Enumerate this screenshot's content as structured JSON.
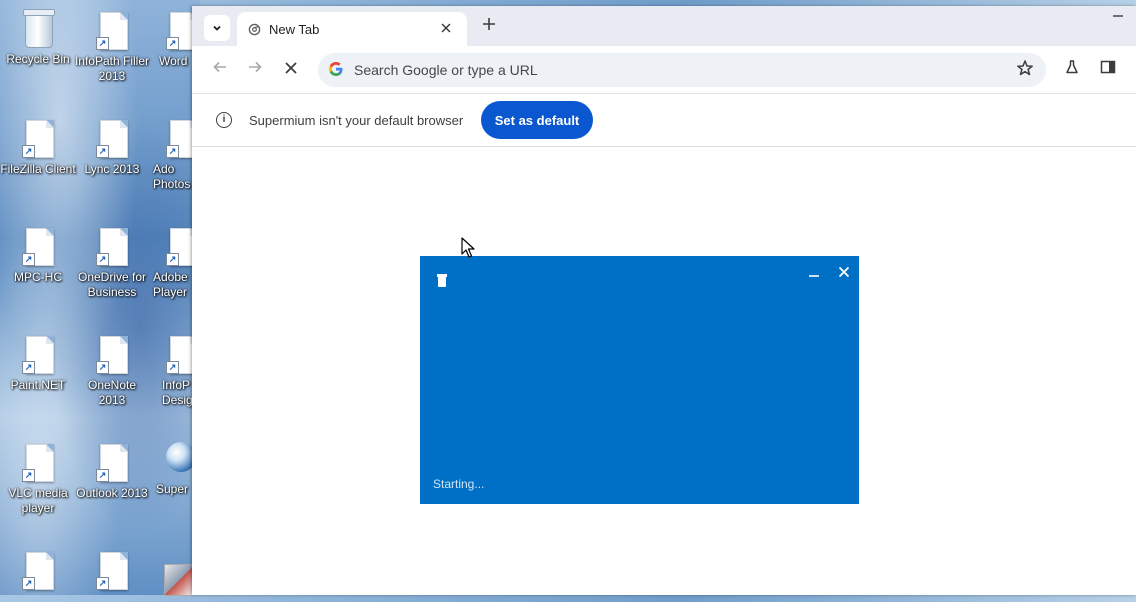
{
  "desktop": {
    "icons": [
      {
        "label": "Recycle Bin",
        "kind": "bin"
      },
      {
        "label": "InfoPath Filler 2013",
        "kind": "doc"
      },
      {
        "label": "Word",
        "kind": "doc"
      },
      {
        "label": "FileZilla Client",
        "kind": "doc"
      },
      {
        "label": "Lync 2013",
        "kind": "doc"
      },
      {
        "label": "Ado Photos",
        "kind": "doc"
      },
      {
        "label": "MPC-HC",
        "kind": "doc"
      },
      {
        "label": "OneDrive for Business",
        "kind": "doc"
      },
      {
        "label": "Adobe Player",
        "kind": "doc"
      },
      {
        "label": "Paint.NET",
        "kind": "doc"
      },
      {
        "label": "OneNote 2013",
        "kind": "doc"
      },
      {
        "label": "InfoP Desig",
        "kind": "doc"
      },
      {
        "label": "VLC media player",
        "kind": "doc"
      },
      {
        "label": "Outlook 2013",
        "kind": "doc"
      },
      {
        "label": "Super",
        "kind": "globe"
      }
    ]
  },
  "browser": {
    "tab": {
      "title": "New Tab"
    },
    "omnibox": {
      "placeholder": "Search Google or type a URL"
    },
    "infobar": {
      "message": "Supermium isn't your default browser",
      "button_label": "Set as default"
    },
    "icons": {
      "tab_search": "chevron-down-icon",
      "tab_close": "close-icon",
      "new_tab": "plus-icon",
      "back": "arrow-left-icon",
      "forward": "arrow-right-icon",
      "stop": "stop-loading-icon",
      "google": "google-icon",
      "bookmark": "star-icon",
      "labs": "flask-icon",
      "side_panel": "side-panel-icon",
      "info": "info-icon"
    },
    "colors": {
      "accent": "#0b57d0",
      "tabstrip": "#e8ecf2"
    }
  },
  "splash": {
    "status": "Starting...",
    "background": "#0070c6"
  }
}
